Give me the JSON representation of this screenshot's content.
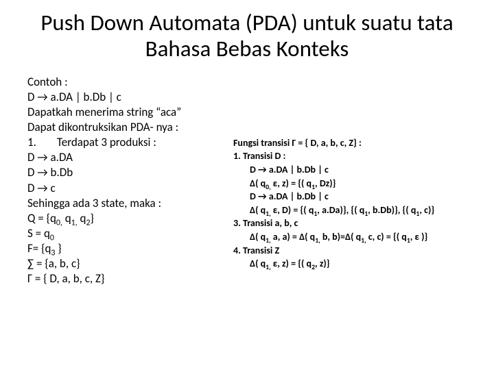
{
  "title": "Push Down Automata (PDA) untuk suatu tata Bahasa Bebas Konteks",
  "left": {
    "l1": "Contoh :",
    "l2": "D → a.DA | b.Db | c",
    "l3": "Dapatkah menerima string “aca”",
    "l4": "Dapat dikontruksikan PDA- nya :",
    "l5_pre": "1.",
    "l5_text": "Terdapat 3 produksi :",
    "l6": "D → a.DA",
    "l7": "D → b.Db",
    "l8": "D → c",
    "l9": "Sehingga ada 3 state, maka :",
    "l10_pre": "Q = {q",
    "l10_s1": "0,",
    "l10_mid1": " q",
    "l10_s2": "1,",
    "l10_mid2": " q",
    "l10_s3": "2",
    "l10_post": "}",
    "l11_pre": "S = q",
    "l11_s": "0",
    "l12_pre": "F= {q",
    "l12_s": "3",
    "l12_post": " }",
    "l13": "∑ = {a, b, c}",
    "l14": "Γ  = { D, a, b, c, Z}"
  },
  "right": {
    "r1": "Fungsi transisi  Γ = { D, a, b, c, Z} :",
    "r2": "1.  Transisi D :",
    "r3": "D → a.DA | b.Db | c",
    "r4_pre": "Δ( q",
    "r4_s1": "0,",
    "r4_mid": " ε, z) = {( q",
    "r4_s2": "1",
    "r4_post": ", Dz)}",
    "r5": "D → a.DA | b.Db | c",
    "r6_pre": "Δ( q",
    "r6_s1": "1,",
    "r6_mid1": " ε, D) = {( q",
    "r6_s2": "1",
    "r6_mid2": ", a.Da)}, {( q",
    "r6_s3": "1",
    "r6_mid3": ", b.Db)}, {( q",
    "r6_s4": "1",
    "r6_post": ", c)}",
    "r7": "3.  Transisi a, b, c",
    "r8_pre": "Δ( q",
    "r8_s1": "1,",
    "r8_mid1": " a, a) = Δ( q",
    "r8_s2": "1,",
    "r8_mid2": " b, b)=Δ( q",
    "r8_s3": "1,",
    "r8_mid3": " c, c) = {( q",
    "r8_s4": "1",
    "r8_post": ", ε )}",
    "r9": "4.  Transisi Z",
    "r10_pre": "Δ( q",
    "r10_s1": "1,",
    "r10_mid": " ε, z) = {( q",
    "r10_s2": "2",
    "r10_post": ", z)}"
  }
}
